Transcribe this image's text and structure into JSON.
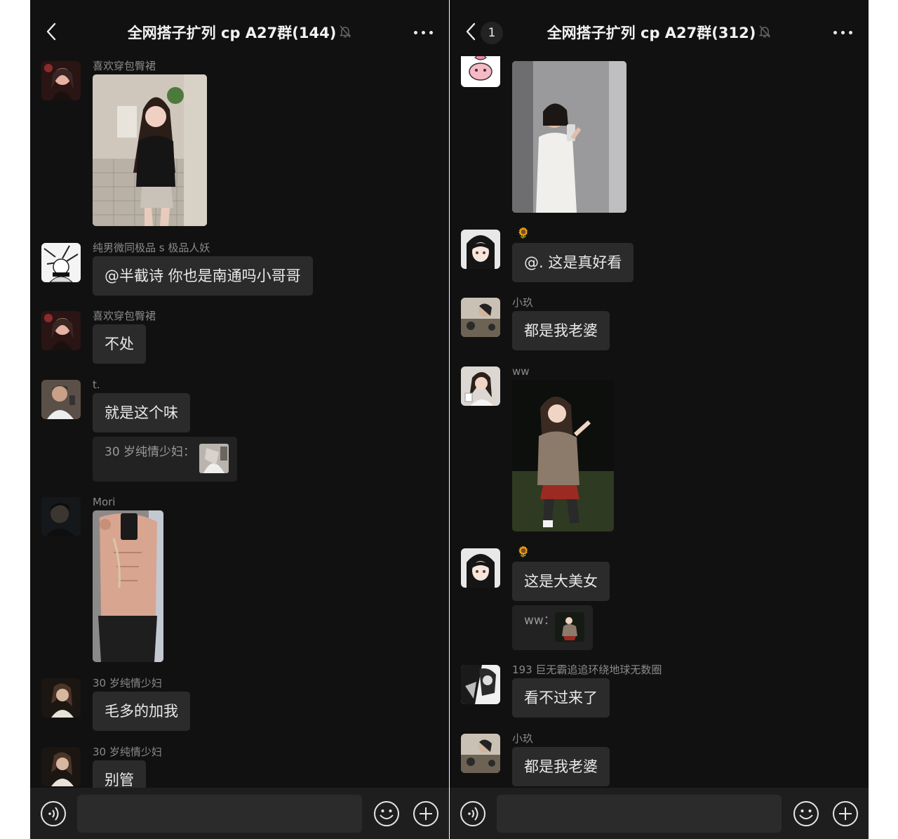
{
  "left_screen": {
    "title": "全网搭子扩列 cp A27群(144)",
    "messages": [
      {
        "sender": "喜欢穿包臀裙"
      },
      {
        "sender": "纯男微同极品 s 极品人妖",
        "text": "@半截诗 你也是南通吗小哥哥"
      },
      {
        "sender": "喜欢穿包臀裙",
        "text": "不处"
      },
      {
        "sender": "t.",
        "text": "就是这个味",
        "quote": "30 岁纯情少妇："
      },
      {
        "sender": "Mori"
      },
      {
        "sender": "30 岁纯情少妇",
        "text": "毛多的加我"
      },
      {
        "sender": "30 岁纯情少妇",
        "text": "别管"
      }
    ]
  },
  "right_screen": {
    "unread_count": "1",
    "title": "全网搭子扩列 cp A27群(312)",
    "messages": [
      {
        "sender": ""
      },
      {
        "sender": ".🌻",
        "text": "@. 这是真好看"
      },
      {
        "sender": "小玖",
        "text": "都是我老婆"
      },
      {
        "sender": "ww"
      },
      {
        "sender": ".🌻",
        "text": "这是大美女",
        "quote": "ww："
      },
      {
        "sender": "193 巨无霸追追环绕地球无数圈",
        "text": "看不过来了"
      },
      {
        "sender": "小玖",
        "text": "都是我老婆"
      }
    ]
  },
  "icons": {
    "back": "chevron-left-icon",
    "more": "more-dots-icon",
    "mute": "bell-off-icon",
    "voice": "voice-icon",
    "emoji": "emoji-icon",
    "add": "plus-circle-icon"
  },
  "colors": {
    "background": "#111111",
    "bubble": "#2b2b2b",
    "quote": "#222222",
    "text": "#e9e9e9",
    "nickname": "#8a8a8a"
  }
}
